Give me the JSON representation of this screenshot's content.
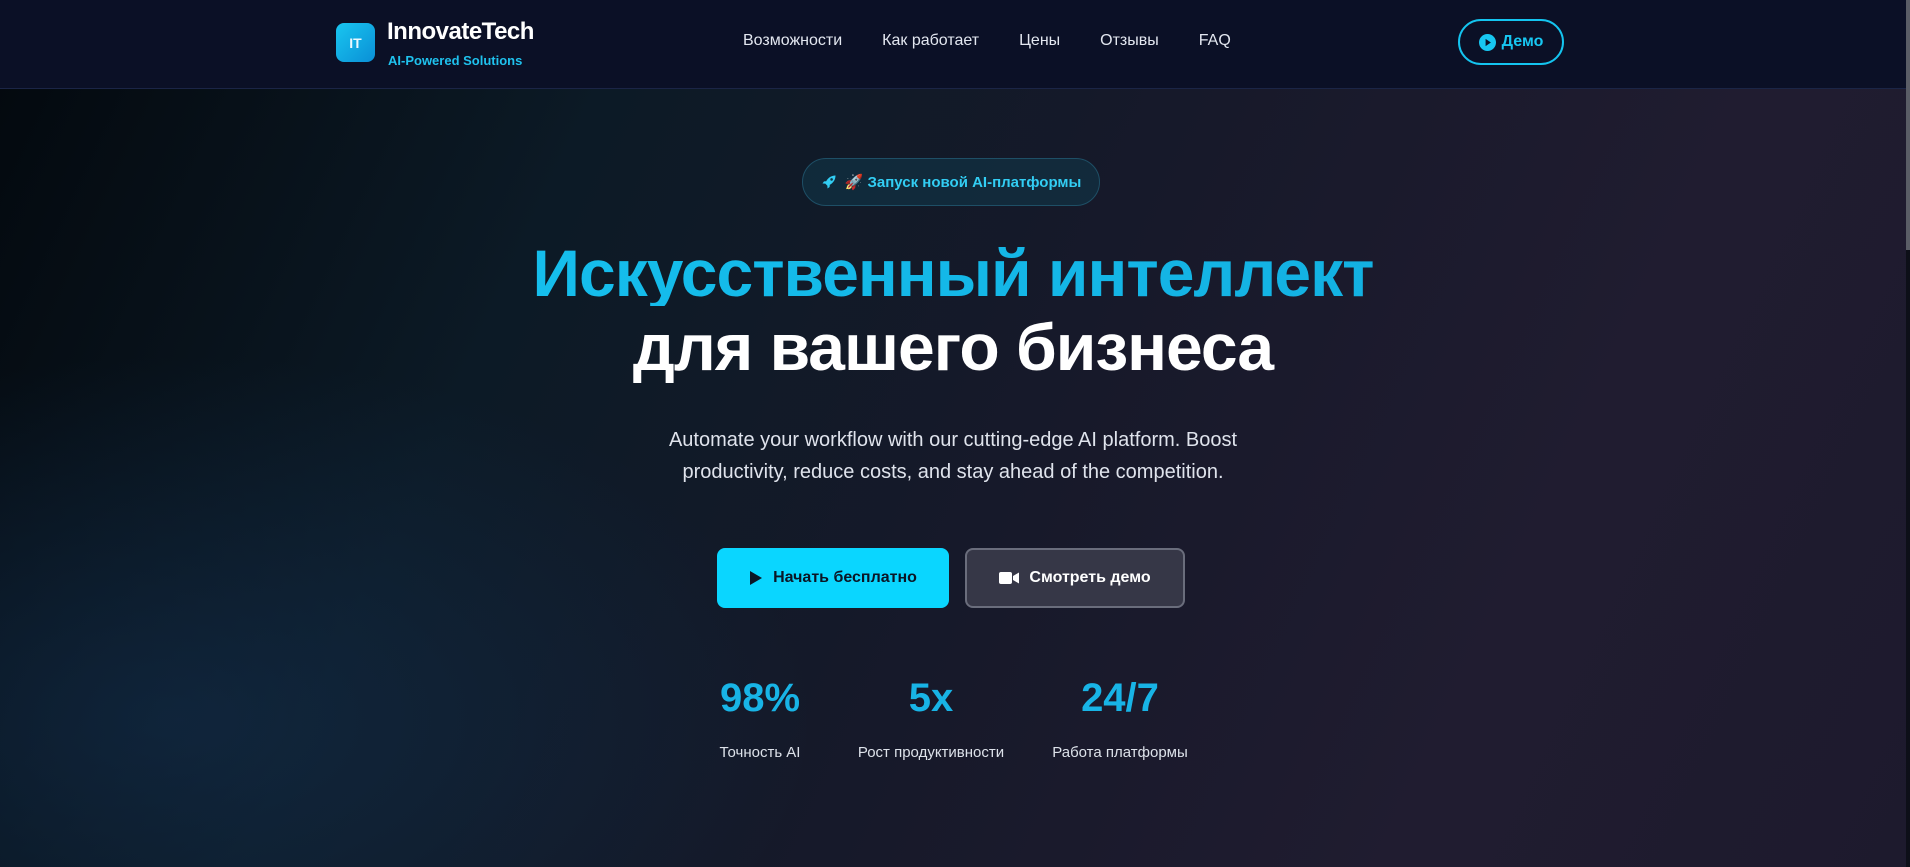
{
  "header": {
    "logo_text": "IT",
    "brand_name": "InnovateTech",
    "brand_tagline": "AI-Powered Solutions",
    "nav": [
      {
        "label": "Возможности"
      },
      {
        "label": "Как работает"
      },
      {
        "label": "Цены"
      },
      {
        "label": "Отзывы"
      },
      {
        "label": "FAQ"
      }
    ],
    "demo_button": {
      "label": "Демо",
      "icon": "play-circle-icon"
    }
  },
  "hero": {
    "badge": {
      "icon": "rocket-icon",
      "text": "🚀 Запуск новой AI-платформы"
    },
    "title_line1": "Искусственный интеллект",
    "title_line2": "для вашего бизнеса",
    "description": "Automate your workflow with our cutting-edge AI platform. Boost productivity, reduce costs, and stay ahead of the competition.",
    "primary_button": {
      "label": "Начать бесплатно",
      "icon": "play-icon"
    },
    "secondary_button": {
      "label": "Смотреть демо",
      "icon": "video-camera-icon"
    }
  },
  "stats": [
    {
      "value": "98%",
      "label": "Точность AI"
    },
    {
      "value": "5x",
      "label": "Рост продуктивности"
    },
    {
      "value": "24/7",
      "label": "Работа платформы"
    }
  ],
  "colors": {
    "accent": "#0ad6ff",
    "accent_text": "#18b4e6",
    "header_bg": "#0b1026"
  }
}
